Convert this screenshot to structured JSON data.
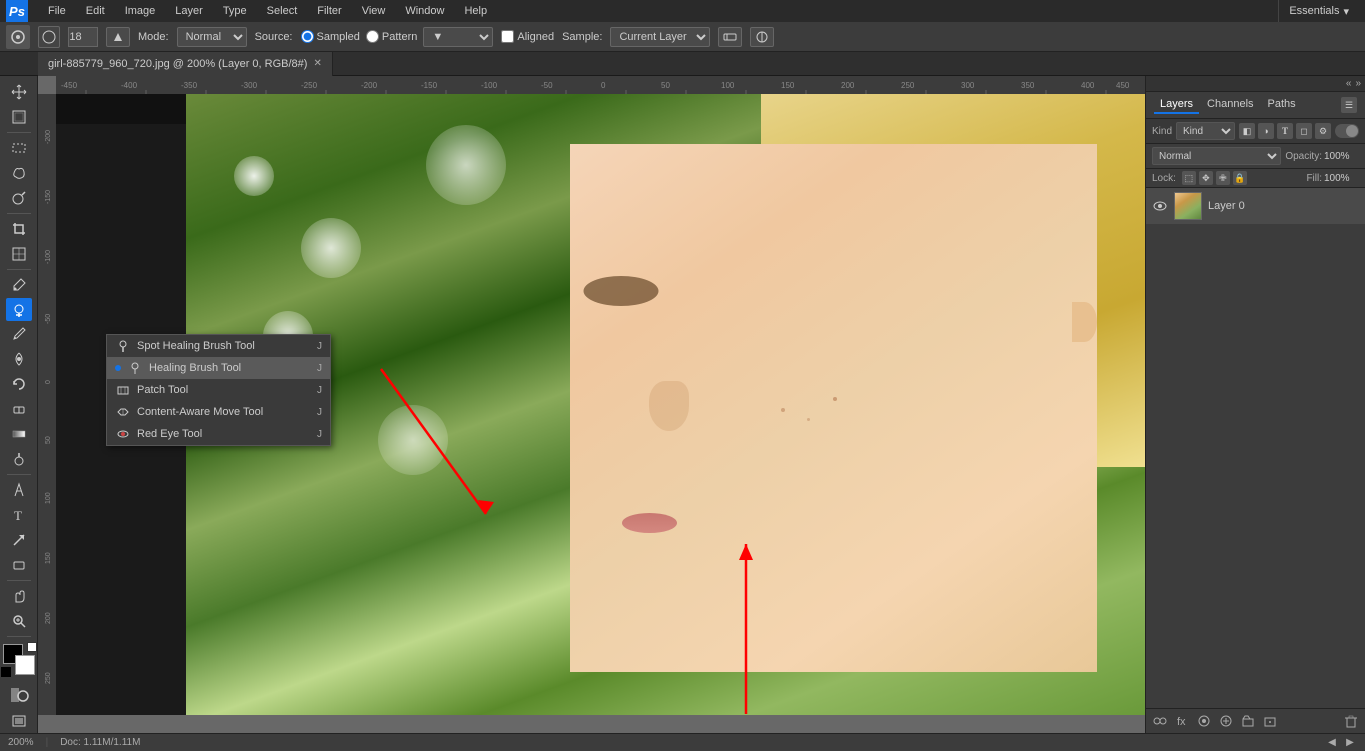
{
  "app": {
    "logo": "Ps",
    "title": "Photoshop"
  },
  "menubar": {
    "items": [
      "File",
      "Edit",
      "Image",
      "Layer",
      "Type",
      "Select",
      "Filter",
      "View",
      "Window",
      "Help"
    ]
  },
  "optionsbar": {
    "brush_size": "18",
    "mode_label": "Mode:",
    "mode_value": "Normal",
    "source_label": "Source:",
    "sampled_label": "Sampled",
    "pattern_label": "Pattern",
    "aligned_label": "Aligned",
    "sample_label": "Sample:",
    "sample_value": "Current Layer",
    "brush_angle_icon": "⟳"
  },
  "tab": {
    "title": "girl-885779_960_720.jpg @ 200% (Layer 0, RGB/8#)",
    "modified": true
  },
  "context_menu": {
    "items": [
      {
        "id": "spot-healing",
        "label": "Spot Healing Brush Tool",
        "shortcut": "J",
        "icon": "spot",
        "active": false
      },
      {
        "id": "healing-brush",
        "label": "Healing Brush Tool",
        "shortcut": "J",
        "icon": "heal",
        "active": true
      },
      {
        "id": "patch",
        "label": "Patch Tool",
        "shortcut": "J",
        "icon": "patch",
        "active": false
      },
      {
        "id": "content-aware",
        "label": "Content-Aware Move Tool",
        "shortcut": "J",
        "icon": "move",
        "active": false
      },
      {
        "id": "red-eye",
        "label": "Red Eye Tool",
        "shortcut": "J",
        "icon": "eye",
        "active": false
      }
    ]
  },
  "right_panel": {
    "tabs": [
      "Layers",
      "Channels",
      "Paths"
    ],
    "active_tab": "Layers",
    "filter": {
      "label": "Kind",
      "icons": [
        "✦",
        "T",
        "🔷",
        "🎨",
        "⚙"
      ]
    },
    "blend_mode": "Normal",
    "opacity_label": "Opacity:",
    "opacity_value": "100%",
    "lock_label": "Lock:",
    "lock_icons": [
      "☐",
      "✥",
      "✏",
      "🔒"
    ],
    "fill_label": "Fill:",
    "fill_value": "100%",
    "layers": [
      {
        "id": "layer0",
        "name": "Layer 0",
        "visible": true
      }
    ]
  },
  "status_bar": {
    "zoom": "200%",
    "doc_info": "Doc: 1.11M/1.11M"
  },
  "essentials": {
    "label": "Essentials"
  },
  "toolbar_tools": [
    {
      "id": "move",
      "symbol": "✛"
    },
    {
      "id": "artboard",
      "symbol": "⬜"
    },
    {
      "id": "marquee",
      "symbol": "⬚"
    },
    {
      "id": "lasso",
      "symbol": "𝓛"
    },
    {
      "id": "quick-select",
      "symbol": "🪄"
    },
    {
      "id": "crop",
      "symbol": "⬓"
    },
    {
      "id": "eyedropper",
      "symbol": "🔍"
    },
    {
      "id": "healing",
      "symbol": "🩹",
      "active": true
    },
    {
      "id": "brush",
      "symbol": "🖌"
    },
    {
      "id": "stamp",
      "symbol": "⬜"
    },
    {
      "id": "eraser",
      "symbol": "◻"
    },
    {
      "id": "gradient",
      "symbol": "▦"
    },
    {
      "id": "dodge",
      "symbol": "◯"
    },
    {
      "id": "pen",
      "symbol": "✒"
    },
    {
      "id": "type",
      "symbol": "T"
    },
    {
      "id": "path-select",
      "symbol": "↖"
    },
    {
      "id": "shape",
      "symbol": "◻"
    },
    {
      "id": "hand",
      "symbol": "✋"
    },
    {
      "id": "zoom",
      "symbol": "🔍"
    }
  ]
}
